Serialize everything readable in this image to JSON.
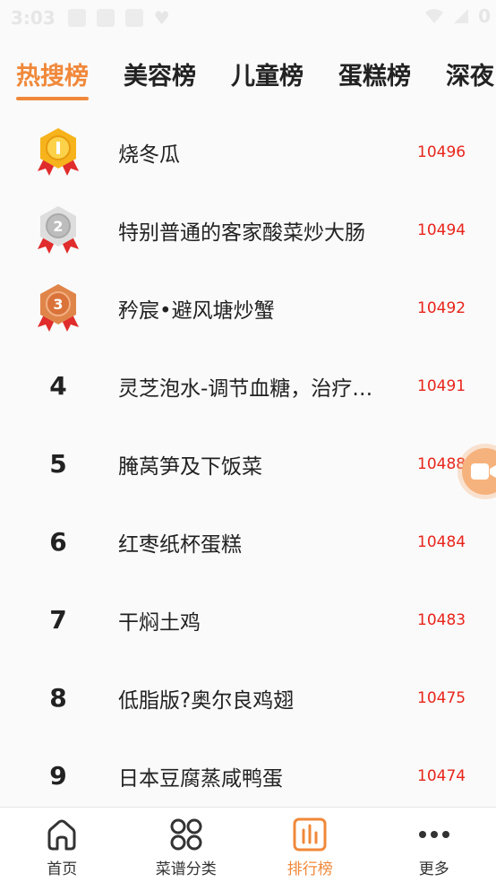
{
  "status_bar": {
    "time": "3:03",
    "battery_text": "0"
  },
  "tabs": [
    {
      "label": "热搜榜",
      "active": true
    },
    {
      "label": "美容榜",
      "active": false
    },
    {
      "label": "儿童榜",
      "active": false
    },
    {
      "label": "蛋糕榜",
      "active": false
    },
    {
      "label": "深夜",
      "active": false
    }
  ],
  "ranking": [
    {
      "rank": "1",
      "medal": "gold",
      "title": "烧冬瓜",
      "count": "10496"
    },
    {
      "rank": "2",
      "medal": "silver",
      "title": "特别普通的客家酸菜炒大肠",
      "count": "10494"
    },
    {
      "rank": "3",
      "medal": "bronze",
      "title": "矜宸•避风塘炒蟹",
      "count": "10492"
    },
    {
      "rank": "4",
      "medal": "",
      "title": "灵芝泡水-调节血糖，治疗…",
      "count": "10491"
    },
    {
      "rank": "5",
      "medal": "",
      "title": "腌莴笋及下饭菜",
      "count": "10488"
    },
    {
      "rank": "6",
      "medal": "",
      "title": "红枣纸杯蛋糕",
      "count": "10484"
    },
    {
      "rank": "7",
      "medal": "",
      "title": "干焖土鸡",
      "count": "10483"
    },
    {
      "rank": "8",
      "medal": "",
      "title": "低脂版?奥尔良鸡翅",
      "count": "10475"
    },
    {
      "rank": "9",
      "medal": "",
      "title": "日本豆腐蒸咸鸭蛋",
      "count": "10474"
    }
  ],
  "bottom_nav": [
    {
      "label": "首页",
      "icon": "home-icon",
      "active": false
    },
    {
      "label": "菜谱分类",
      "icon": "grid-icon",
      "active": false
    },
    {
      "label": "排行榜",
      "icon": "chart-icon",
      "active": true
    },
    {
      "label": "更多",
      "icon": "more-icon",
      "active": false
    }
  ],
  "colors": {
    "accent": "#f0883a",
    "count": "#e8251c",
    "gold": "#f6b31c",
    "silver": "#c9c9c9",
    "bronze": "#e0854a",
    "ribbon": "#e02c2c"
  }
}
